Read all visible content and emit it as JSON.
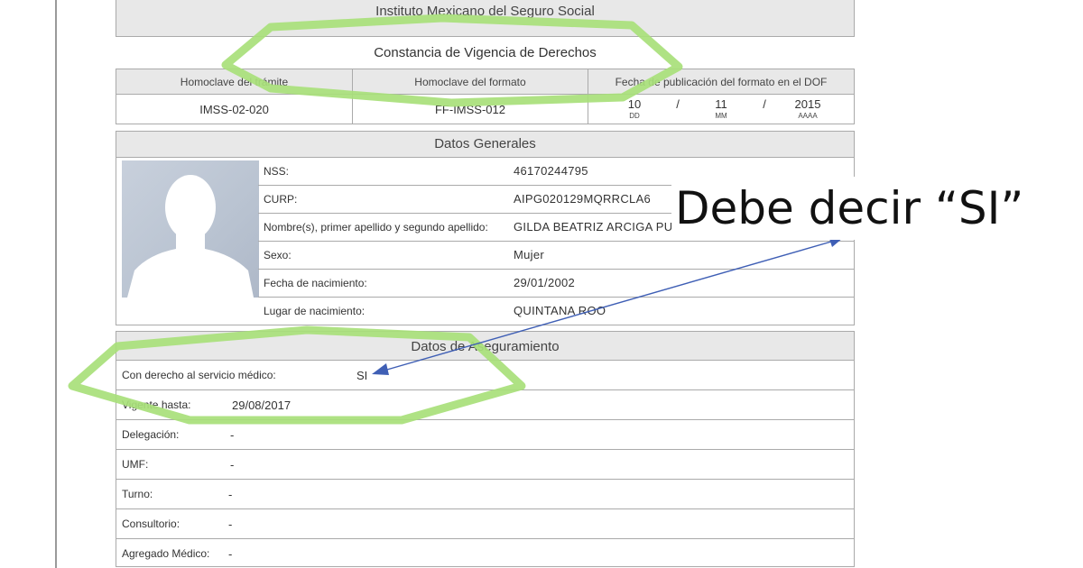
{
  "institute": "Instituto Mexicano del Seguro Social",
  "title": "Constancia de Vigencia de Derechos",
  "homoclave": {
    "headers": [
      "Homoclave del trámite",
      "Homoclave del formato",
      "Fecha de publicación del formato en el DOF"
    ],
    "tramite": "IMSS-02-020",
    "formato": "FF-IMSS-012",
    "dof_date": {
      "day": "10",
      "day_label": "DD",
      "month": "11",
      "month_label": "MM",
      "year": "2015",
      "year_label": "AAAA",
      "separator": "/"
    }
  },
  "generales": {
    "title": "Datos Generales",
    "rows": [
      {
        "label": "NSS:",
        "value": "46170244795"
      },
      {
        "label": "CURP:",
        "value": "AIPG020129MQRRCLA6"
      },
      {
        "label": "Nombre(s), primer apellido y segundo apellido:",
        "value": "GILDA BEATRIZ ARCIGA PUC"
      },
      {
        "label": "Sexo:",
        "value": "Mujer"
      },
      {
        "label": "Fecha de nacimiento:",
        "value": "29/01/2002"
      },
      {
        "label": "Lugar de nacimiento:",
        "value": "QUINTANA ROO"
      }
    ]
  },
  "aseguramiento": {
    "title": "Datos de Aseguramiento",
    "rows": [
      {
        "label": "Con derecho al servicio médico:",
        "value": "SI"
      },
      {
        "label": "Vigente hasta:",
        "value": "29/08/2017"
      },
      {
        "label": "Delegación:",
        "value": "-"
      },
      {
        "label": "UMF:",
        "value": "-"
      },
      {
        "label": "Turno:",
        "value": "-"
      },
      {
        "label": "Consultorio:",
        "value": "-"
      },
      {
        "label": "Agregado Médico:",
        "value": "-"
      }
    ]
  },
  "annotation": {
    "text": "Debe decir  “SI”",
    "highlight_color": "#a8e07a",
    "arrow_color": "#3f5fb5"
  }
}
